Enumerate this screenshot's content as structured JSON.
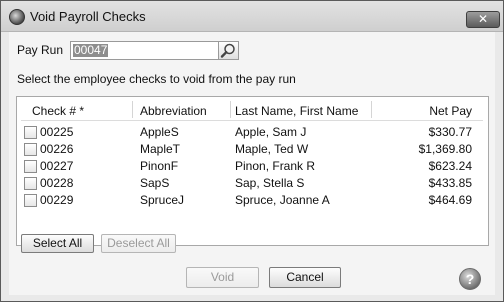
{
  "window": {
    "title": "Void Payroll Checks",
    "close_label": "✕"
  },
  "pay_run": {
    "label": "Pay Run",
    "value": "00047"
  },
  "instructions": "Select the employee checks to void from the pay run",
  "table": {
    "columns": [
      "Check # *",
      "Abbreviation",
      "Last Name, First Name",
      "Net Pay"
    ],
    "rows": [
      {
        "check": "00225",
        "abbr": "AppleS",
        "name": "Apple, Sam J",
        "net": "$330.77",
        "checked": false
      },
      {
        "check": "00226",
        "abbr": "MapleT",
        "name": "Maple, Ted W",
        "net": "$1,369.80",
        "checked": false
      },
      {
        "check": "00227",
        "abbr": "PinonF",
        "name": "Pinon, Frank R",
        "net": "$623.24",
        "checked": false
      },
      {
        "check": "00228",
        "abbr": "SapS",
        "name": "Sap, Stella S",
        "net": "$433.85",
        "checked": false
      },
      {
        "check": "00229",
        "abbr": "SpruceJ",
        "name": "Spruce, Joanne A",
        "net": "$464.69",
        "checked": false
      }
    ]
  },
  "buttons": {
    "select_all": "Select All",
    "deselect_all": "Deselect All",
    "void": "Void",
    "cancel": "Cancel",
    "help": "?"
  }
}
